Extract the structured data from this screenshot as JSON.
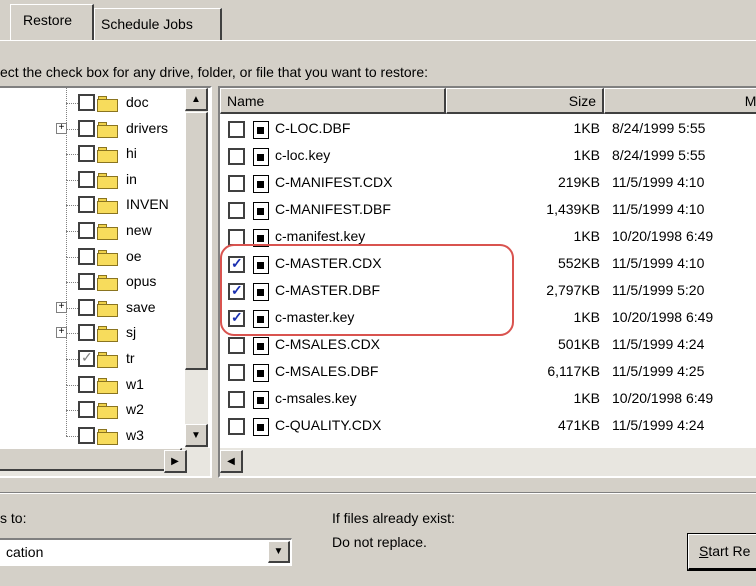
{
  "tabs": [
    {
      "label": "Restore",
      "active": true
    },
    {
      "label": "Schedule Jobs",
      "active": false
    }
  ],
  "instruction": "ect the check box for any drive, folder, or file that you want to restore:",
  "tree": {
    "items": [
      {
        "label": "doc",
        "expander": "",
        "checked": false
      },
      {
        "label": "drivers",
        "expander": "+",
        "checked": false
      },
      {
        "label": "hi",
        "expander": "",
        "checked": false
      },
      {
        "label": "in",
        "expander": "",
        "checked": false
      },
      {
        "label": "INVEN",
        "expander": "",
        "checked": false
      },
      {
        "label": "new",
        "expander": "",
        "checked": false
      },
      {
        "label": "oe",
        "expander": "",
        "checked": false
      },
      {
        "label": "opus",
        "expander": "",
        "checked": false
      },
      {
        "label": "save",
        "expander": "+",
        "checked": false
      },
      {
        "label": "sj",
        "expander": "+",
        "checked": false
      },
      {
        "label": "tr",
        "expander": "",
        "checked": true
      },
      {
        "label": "w1",
        "expander": "",
        "checked": false
      },
      {
        "label": "w2",
        "expander": "",
        "checked": false
      },
      {
        "label": "w3",
        "expander": "",
        "checked": false
      }
    ]
  },
  "list": {
    "columns": [
      "Name",
      "Size",
      "Mod"
    ],
    "rows": [
      {
        "name": "C-LOC.DBF",
        "size": "1KB",
        "modified": "8/24/1999 5:55",
        "checked": false
      },
      {
        "name": "c-loc.key",
        "size": "1KB",
        "modified": "8/24/1999 5:55",
        "checked": false
      },
      {
        "name": "C-MANIFEST.CDX",
        "size": "219KB",
        "modified": "11/5/1999 4:10",
        "checked": false
      },
      {
        "name": "C-MANIFEST.DBF",
        "size": "1,439KB",
        "modified": "11/5/1999 4:10",
        "checked": false
      },
      {
        "name": "c-manifest.key",
        "size": "1KB",
        "modified": "10/20/1998 6:49",
        "checked": false
      },
      {
        "name": "C-MASTER.CDX",
        "size": "552KB",
        "modified": "11/5/1999 4:10",
        "checked": true
      },
      {
        "name": "C-MASTER.DBF",
        "size": "2,797KB",
        "modified": "11/5/1999 5:20",
        "checked": true
      },
      {
        "name": "c-master.key",
        "size": "1KB",
        "modified": "10/20/1998 6:49",
        "checked": true
      },
      {
        "name": "C-MSALES.CDX",
        "size": "501KB",
        "modified": "11/5/1999 4:24",
        "checked": false
      },
      {
        "name": "C-MSALES.DBF",
        "size": "6,117KB",
        "modified": "11/5/1999 4:25",
        "checked": false
      },
      {
        "name": "c-msales.key",
        "size": "1KB",
        "modified": "10/20/1998 6:49",
        "checked": false
      },
      {
        "name": "C-QUALITY.CDX",
        "size": "471KB",
        "modified": "11/5/1999 4:24",
        "checked": false
      }
    ]
  },
  "restore_to": {
    "label": "s to:",
    "value": "cation"
  },
  "if_exist": {
    "label": "If files already exist:",
    "value": "Do not replace."
  },
  "start_button": {
    "label_first": "S",
    "label_rest": "tart Re"
  },
  "colors": {
    "window_bg": "#d4d0c8",
    "highlight": "#d9534f",
    "check_blue": "#1a2fb0"
  }
}
